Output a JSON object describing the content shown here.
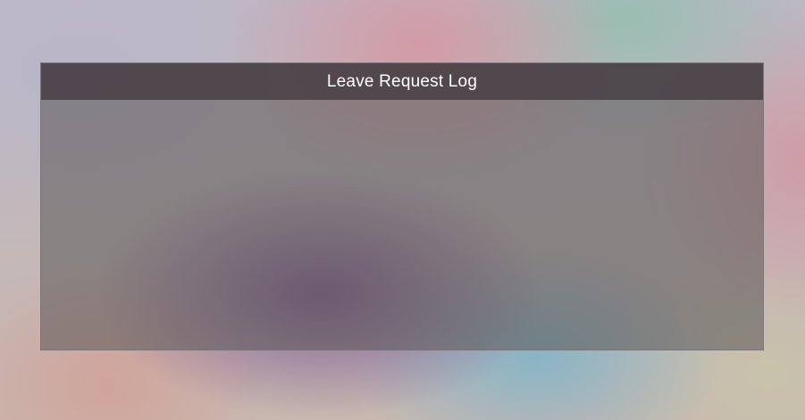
{
  "window": {
    "title": "Leave Request Log"
  }
}
